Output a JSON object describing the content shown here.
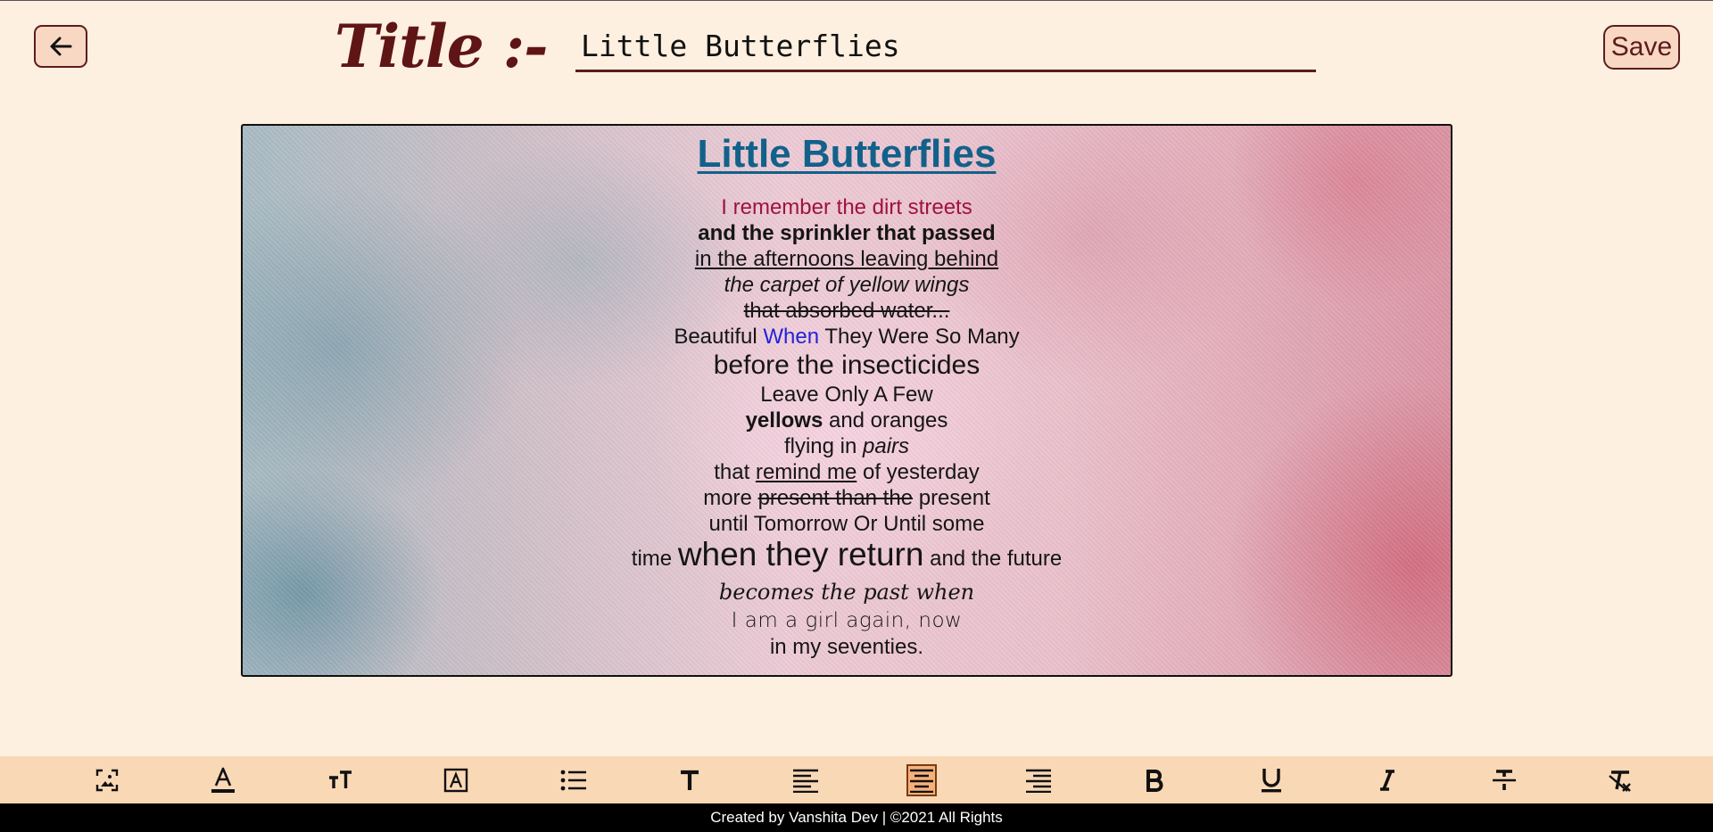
{
  "header": {
    "title_label": "Title :-",
    "title_value": "Little Butterflies",
    "save_label": "Save"
  },
  "poem": {
    "title": "Little Butterflies",
    "line1": "I remember the dirt streets",
    "line2": "and the sprinkler that passed",
    "line3": "in the afternoons leaving behind",
    "line4": "the carpet of yellow wings",
    "line5": "that absorbed water...",
    "line6a": "Beautiful ",
    "line6b": "When",
    "line6c": " They Were So Many",
    "line7": "before the insecticides",
    "line8": "Leave Only A Few",
    "line9a": "yellows",
    "line9b": " and oranges",
    "line10a": "flying in ",
    "line10b": "pairs",
    "line11a": "that ",
    "line11b": "remind me",
    "line11c": " of yesterday",
    "line12a": "more ",
    "line12b": "present than the",
    "line12c": " present",
    "line13": "until Tomorrow Or Until some",
    "line14a": "time ",
    "line14b": "when they return",
    "line14c": " and the future",
    "line15": "becomes the past when",
    "line16": "I am a girl again, now",
    "line17": "in my seventies."
  },
  "toolbar": {
    "tools": [
      "background-image",
      "text-color",
      "font-size",
      "text-background",
      "list",
      "font-family",
      "align-left",
      "align-center",
      "align-right",
      "bold",
      "underline",
      "italic",
      "strikethrough",
      "clear-format"
    ],
    "active": "align-center"
  },
  "footer": {
    "text": "Created by Vanshita Dev | ©2021 All Rights"
  },
  "colors": {
    "background": "#fdf0e0",
    "accent": "#5b1c1c",
    "toolbar": "#f9d8b5",
    "poem_title": "#12618b"
  }
}
